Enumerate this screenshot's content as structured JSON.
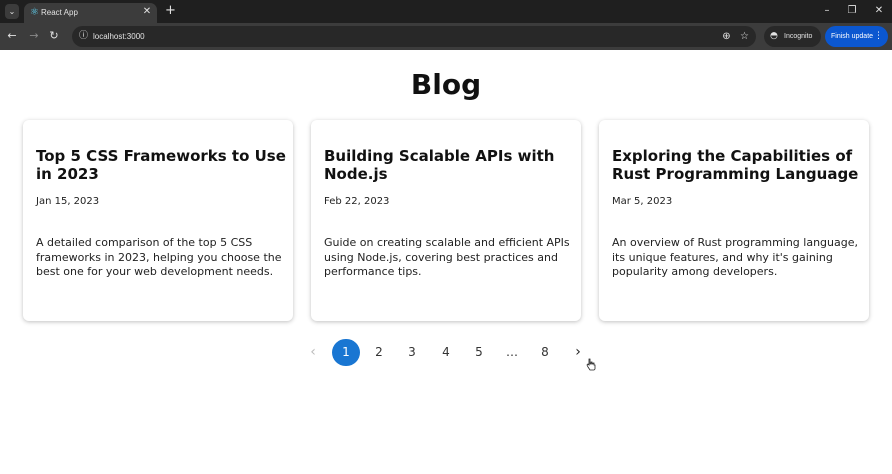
{
  "browser": {
    "tab": {
      "title": "React App",
      "favicon": "react-icon"
    },
    "url": "localhost:3000",
    "incognito_label": "Incognito",
    "update_label": "Finish update"
  },
  "page": {
    "title": "Blog",
    "posts": [
      {
        "title": "Top 5 CSS Frameworks to Use in 2023",
        "date": "Jan 15, 2023",
        "description": "A detailed comparison of the top 5 CSS frameworks in 2023, helping you choose the best one for your web development needs."
      },
      {
        "title": "Building Scalable APIs with Node.js",
        "date": "Feb 22, 2023",
        "description": "Guide on creating scalable and efficient APIs using Node.js, covering best practices and performance tips."
      },
      {
        "title": "Exploring the Capabilities of Rust Programming Language",
        "date": "Mar 5, 2023",
        "description": "An overview of Rust programming language, its unique features, and why it's gaining popularity among developers."
      }
    ],
    "pagination": {
      "pages": [
        "1",
        "2",
        "3",
        "4",
        "5",
        "…",
        "8"
      ],
      "current": "1",
      "accent": "#1976d2"
    }
  }
}
